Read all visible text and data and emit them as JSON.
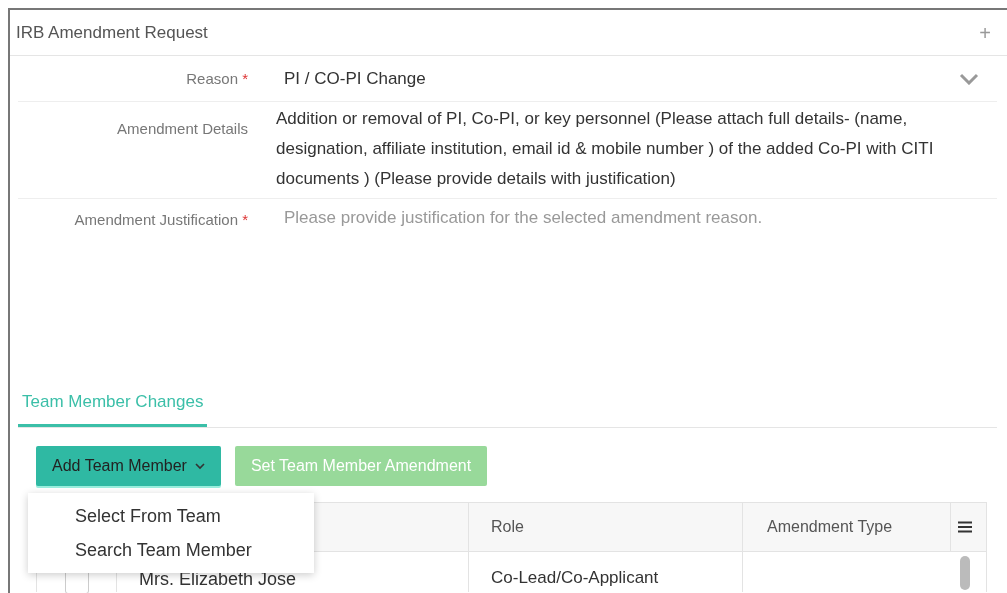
{
  "window": {
    "title": "IRB Amendment Request",
    "add_button": "+"
  },
  "form": [
    {
      "kind": "select",
      "label": "Reason",
      "required_mark": "*",
      "value": "PI / CO-PI Change"
    },
    {
      "kind": "text",
      "label": "Amendment Details",
      "value": "Addition or removal of PI, Co-PI, or key personnel (Please attach full details- (name, designation, affiliate institution, email id & mobile number ) of the added Co-PI with CITI documents ) (Please provide details with justification)"
    },
    {
      "kind": "textarea",
      "label": "Amendment Justification",
      "required_mark": "*",
      "placeholder": "Please provide justification for the selected amendment reason."
    }
  ],
  "tabs": [
    {
      "label": "Team Member Changes",
      "selected": true
    }
  ],
  "buttons": [
    {
      "label": "Add Team Member",
      "kind": "dropdown",
      "expanded": true,
      "disabled": false
    },
    {
      "label": "Set Team Member Amendment",
      "kind": "plain",
      "disabled": true
    }
  ],
  "dropdown_menu": [
    "Select From Team",
    "Search Team Member"
  ],
  "table": {
    "columns": [
      "Role",
      "Amendment Type"
    ],
    "rows": [
      {
        "checked": false,
        "name": "Mrs. Elizabeth Jose",
        "role": "Co-Lead/Co-Applicant",
        "amendment_type": ""
      }
    ]
  }
}
